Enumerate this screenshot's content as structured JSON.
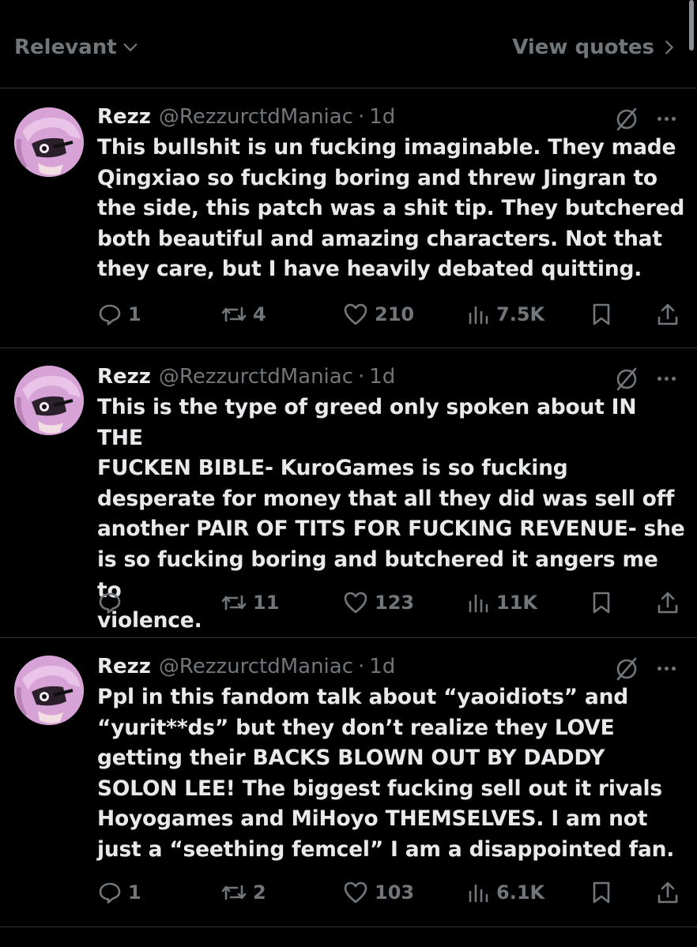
{
  "header": {
    "filter_label": "Relevant",
    "view_quotes_label": "View quotes"
  },
  "icons": {
    "reply": "speech-bubble-icon",
    "retweet": "retweet-arrows-icon",
    "like": "heart-icon",
    "views": "bar-chart-icon",
    "bookmark": "bookmark-icon",
    "share": "share-upload-icon",
    "grok": "grok-slash-circle-icon",
    "more": "horizontal-ellipsis-icon"
  },
  "colors": {
    "background": "#000000",
    "text": "#e7e9ea",
    "muted": "#71767b",
    "divider": "#2f3336",
    "avatar": "#d9a6d8"
  },
  "tweets": [
    {
      "name": "Rezz",
      "handle": "@RezzurctdManiac",
      "dot": "·",
      "time": "1d",
      "text": "This bullshit is un fucking imaginable. They made\nQingxiao so fucking boring and threw Jingran to\nthe side, this patch was a shit tip. They butchered\nboth beautiful and amazing characters. Not that\nthey care, but I have heavily debated quitting.",
      "replies": "1",
      "reposts": "4",
      "likes": "210",
      "views": "7.5K"
    },
    {
      "name": "Rezz",
      "handle": "@RezzurctdManiac",
      "dot": "·",
      "time": "1d",
      "text": "This is the type of greed only spoken about IN THE\nFUCKEN BIBLE- KuroGames is so fucking\ndesperate for money that all they did was sell off\nanother PAIR OF TITS FOR FUCKING REVENUE- she\nis so fucking boring and butchered it angers me to\nviolence.",
      "replies": "",
      "reposts": "11",
      "likes": "123",
      "views": "11K"
    },
    {
      "name": "Rezz",
      "handle": "@RezzurctdManiac",
      "dot": "·",
      "time": "1d",
      "text": "Ppl in this fandom talk about “yaoidiots” and\n“yurit**ds” but they don’t realize they LOVE\ngetting their BACKS BLOWN OUT BY DADDY\nSOLON LEE! The biggest fucking sell out it rivals\nHoyogames and MiHoyo THEMSELVES. I am not\njust a “seething femcel” I am a disappointed fan.",
      "replies": "1",
      "reposts": "2",
      "likes": "103",
      "views": "6.1K"
    }
  ]
}
